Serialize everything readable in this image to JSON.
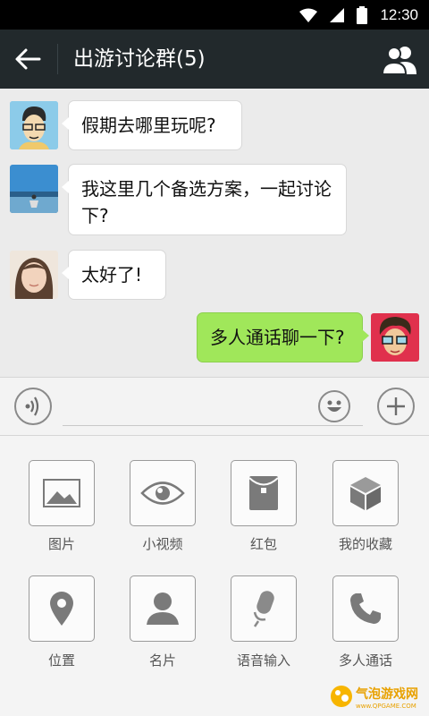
{
  "status_bar": {
    "time": "12:30"
  },
  "header": {
    "title": "出游讨论群(5)"
  },
  "messages": [
    {
      "side": "left",
      "text": "假期去哪里玩呢?"
    },
    {
      "side": "left",
      "text": "我这里几个备选方案，一起讨论下?"
    },
    {
      "side": "left",
      "text": "太好了!"
    },
    {
      "side": "right",
      "text": "多人通话聊一下?"
    }
  ],
  "input": {
    "placeholder": ""
  },
  "panel": {
    "items": [
      {
        "label": "图片",
        "icon": "image-icon"
      },
      {
        "label": "小视频",
        "icon": "eye-icon"
      },
      {
        "label": "红包",
        "icon": "red-packet-icon"
      },
      {
        "label": "我的收藏",
        "icon": "cube-icon"
      },
      {
        "label": "位置",
        "icon": "location-pin-icon"
      },
      {
        "label": "名片",
        "icon": "person-icon"
      },
      {
        "label": "语音输入",
        "icon": "microphone-icon"
      },
      {
        "label": "多人通话",
        "icon": "phone-icon"
      }
    ]
  },
  "watermark": {
    "text": "气泡游戏网",
    "url_text": "www.QPGAME.COM"
  },
  "colors": {
    "titlebar": "#22292c",
    "sent_bubble": "#a0e75a",
    "background": "#ebebeb"
  }
}
